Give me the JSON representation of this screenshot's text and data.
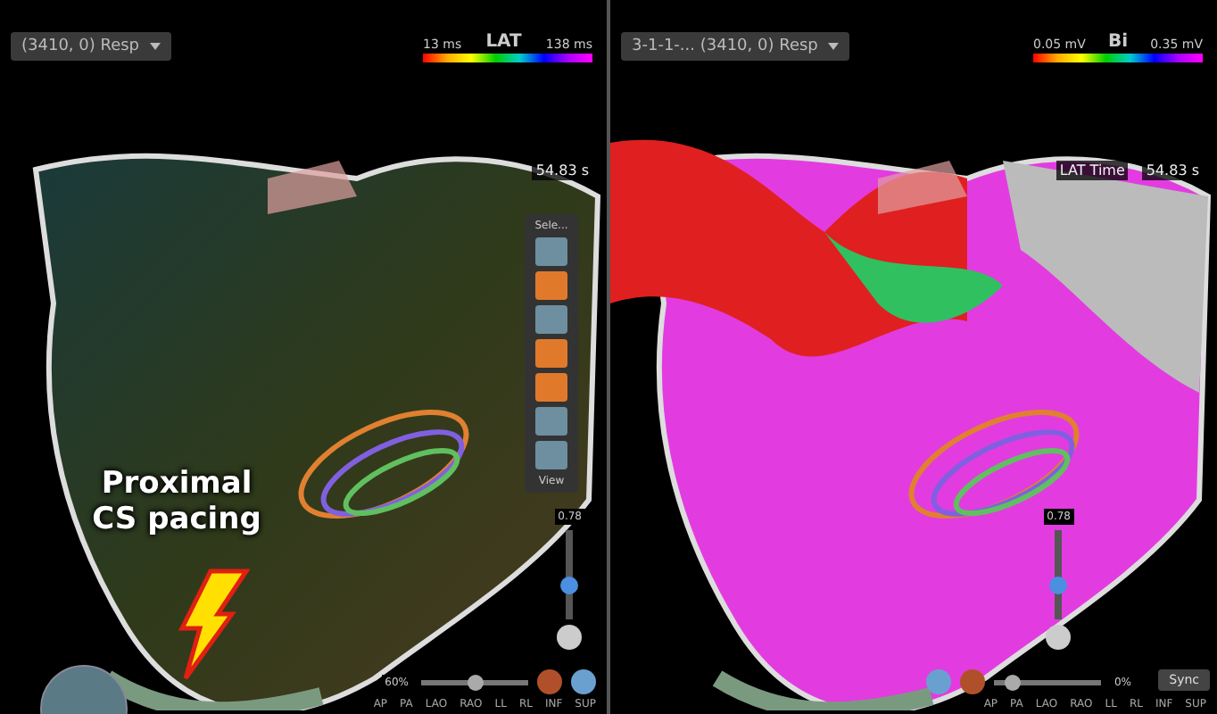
{
  "panels": [
    {
      "kind": "lat",
      "dropdown": "(3410, 0) Resp",
      "legend": {
        "min": "13 ms",
        "title": "LAT",
        "max": "138 ms"
      },
      "time": "54.83 s",
      "opacity": {
        "value": "0.78",
        "level": 0.35
      },
      "zoom": {
        "label": "60%",
        "label_first": true,
        "level": 0.5
      },
      "views": [
        "AP",
        "PA",
        "LAO",
        "RAO",
        "LL",
        "RL",
        "INF",
        "SUP"
      ],
      "toolbar": {
        "title": "Sele...",
        "footer": "View",
        "tools": [
          {
            "active": false
          },
          {
            "active": true
          },
          {
            "active": false
          },
          {
            "active": true
          },
          {
            "active": true
          },
          {
            "active": false
          },
          {
            "active": false
          }
        ]
      }
    },
    {
      "kind": "voltage",
      "dropdown": "3-1-1-... (3410, 0) Resp",
      "legend": {
        "min": "0.05 mV",
        "title": "Bi",
        "max": "0.35 mV"
      },
      "time_label": "LAT Time",
      "time": "54.83 s",
      "opacity": {
        "value": "0.78",
        "level": 0.35
      },
      "zoom": {
        "label": "0%",
        "label_first": false,
        "level": 0.1
      },
      "views": [
        "AP",
        "PA",
        "LAO",
        "RAO",
        "LL",
        "RL",
        "INF",
        "SUP"
      ]
    }
  ],
  "annotation": "Proximal CS pacing",
  "sync": "Sync"
}
